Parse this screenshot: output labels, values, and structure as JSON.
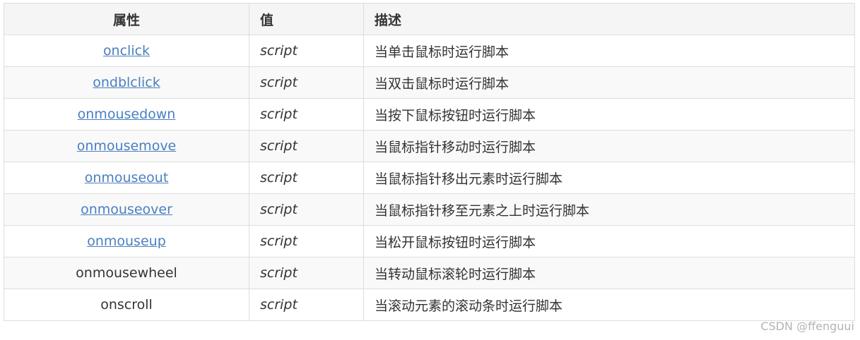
{
  "headers": {
    "attribute": "属性",
    "value": "值",
    "description": "描述"
  },
  "rows": [
    {
      "attribute": "onclick",
      "is_link": true,
      "value": "script",
      "description": "当单击鼠标时运行脚本"
    },
    {
      "attribute": "ondblclick",
      "is_link": true,
      "value": "script",
      "description": "当双击鼠标时运行脚本"
    },
    {
      "attribute": "onmousedown",
      "is_link": true,
      "value": "script",
      "description": "当按下鼠标按钮时运行脚本"
    },
    {
      "attribute": "onmousemove",
      "is_link": true,
      "value": "script",
      "description": "当鼠标指针移动时运行脚本"
    },
    {
      "attribute": "onmouseout",
      "is_link": true,
      "value": "script",
      "description": "当鼠标指针移出元素时运行脚本"
    },
    {
      "attribute": "onmouseover",
      "is_link": true,
      "value": "script",
      "description": "当鼠标指针移至元素之上时运行脚本"
    },
    {
      "attribute": "onmouseup",
      "is_link": true,
      "value": "script",
      "description": "当松开鼠标按钮时运行脚本"
    },
    {
      "attribute": "onmousewheel",
      "is_link": false,
      "value": "script",
      "description": "当转动鼠标滚轮时运行脚本"
    },
    {
      "attribute": "onscroll",
      "is_link": false,
      "value": "script",
      "description": "当滚动元素的滚动条时运行脚本"
    }
  ],
  "watermark": "CSDN @ffenguui",
  "colors": {
    "link": "#4a7fc1",
    "text": "#333333",
    "header_bg": "#f5f5f5",
    "border": "#dddddd"
  }
}
